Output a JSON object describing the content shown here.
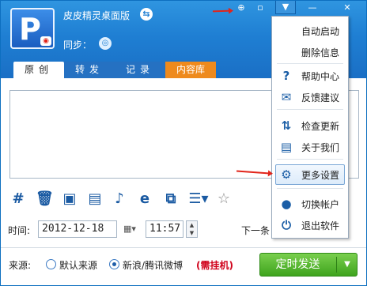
{
  "app": {
    "title": "皮皮精灵桌面版",
    "sync_label": "同步："
  },
  "titlebar": {
    "pin_glyph": "⊕",
    "restore_glyph": "▫",
    "menu_glyph": "▼",
    "min_glyph": "—",
    "close_glyph": "✕"
  },
  "tabs": [
    {
      "label": "原创",
      "active": true
    },
    {
      "label": "转发",
      "active": false
    },
    {
      "label": "记录",
      "active": false
    },
    {
      "label": "内容库",
      "active": false
    }
  ],
  "toolbar_icons": [
    "hash-icon",
    "trash-icon",
    "image-icon",
    "video-icon",
    "music-icon",
    "ie-icon",
    "copy-icon",
    "list-dropdown-icon",
    "star-icon"
  ],
  "schedule": {
    "time_label": "时间:",
    "date": "2012-12-18",
    "time": "11:57",
    "next_label": "下一条"
  },
  "source": {
    "label": "来源:",
    "option_default": "默认来源",
    "option_weibo": "新浪/腾讯微博",
    "need_hang": "(需挂机)",
    "selected": "option_weibo"
  },
  "send": {
    "label": "定时发送"
  },
  "menu": {
    "items": [
      {
        "label": "自动启动",
        "icon": ""
      },
      {
        "label": "删除信息",
        "icon": ""
      },
      {
        "label": "帮助中心",
        "icon": "help-icon"
      },
      {
        "label": "反馈建议",
        "icon": "mail-icon"
      },
      {
        "label": "检查更新",
        "icon": "refresh-icon"
      },
      {
        "label": "关于我们",
        "icon": "document-icon"
      },
      {
        "label": "更多设置",
        "icon": "gear-icon"
      },
      {
        "label": "切换帐户",
        "icon": "user-icon"
      },
      {
        "label": "退出软件",
        "icon": "power-icon"
      }
    ]
  },
  "colors": {
    "header_blue": "#1f7fd3",
    "tab_orange": "#ee8a1d",
    "send_green": "#3fa41e",
    "annotation_red": "#e1251b"
  }
}
